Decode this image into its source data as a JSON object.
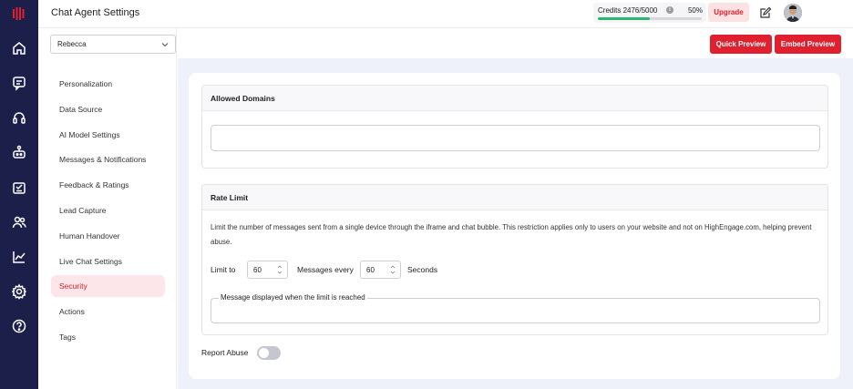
{
  "header": {
    "title": "Chat Agent Settings",
    "credits_label": "Credits 2476/5000",
    "credits_percent": "50%",
    "credits_fraction": 0.5,
    "upgrade_label": "Upgrade"
  },
  "agent_select": {
    "value": "Rebecca"
  },
  "actions": {
    "quick_preview": "Quick Preview",
    "embed_preview": "Embed Preview"
  },
  "menu": [
    {
      "label": "Personalization",
      "active": false
    },
    {
      "label": "Data Source",
      "active": false
    },
    {
      "label": "AI Model Settings",
      "active": false
    },
    {
      "label": "Messages & Notifications",
      "active": false
    },
    {
      "label": "Feedback & Ratings",
      "active": false
    },
    {
      "label": "Lead Capture",
      "active": false
    },
    {
      "label": "Human Handover",
      "active": false
    },
    {
      "label": "Live Chat Settings",
      "active": false
    },
    {
      "label": "Security",
      "active": true
    },
    {
      "label": "Actions",
      "active": false
    },
    {
      "label": "Tags",
      "active": false
    }
  ],
  "rail_icons": [
    "home-icon",
    "chat-icon",
    "headset-icon",
    "bot-icon",
    "clipboard-icon",
    "users-icon",
    "analytics-icon",
    "settings-icon",
    "help-icon"
  ],
  "allowed_domains": {
    "title": "Allowed Domains",
    "value": ""
  },
  "rate_limit": {
    "title": "Rate Limit",
    "description": "Limit the number of messages sent from a single device through the iframe and chat bubble. This restriction applies only to users on your website and not on HighEngage.com, helping prevent abuse.",
    "limit_to_label": "Limit to",
    "limit_value": "60",
    "messages_every_label": "Messages every",
    "seconds_value": "60",
    "seconds_label": "Seconds",
    "limit_message_label": "Message displayed when the limit is reached",
    "limit_message_value": ""
  },
  "report_abuse": {
    "label": "Report Abuse",
    "enabled": false
  },
  "colors": {
    "rail": "#1c1f4a",
    "accent": "#e0202f",
    "active_bg": "#fde6ea",
    "progress": "#2bb673",
    "main_bg": "#eef0fa"
  }
}
